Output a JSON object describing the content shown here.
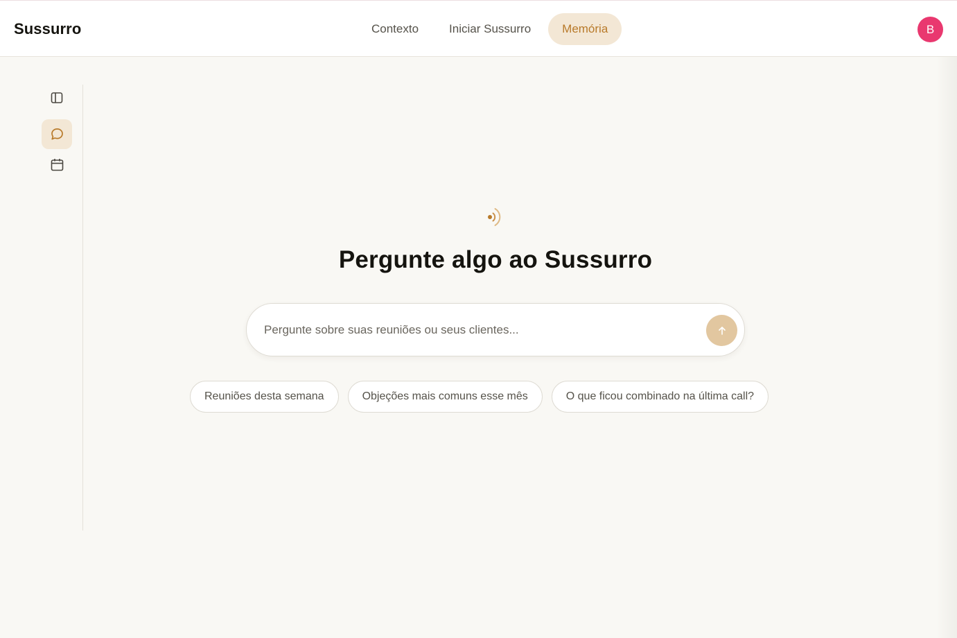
{
  "app": {
    "brand": "Sussurro"
  },
  "nav": {
    "items": [
      {
        "label": "Contexto",
        "active": false
      },
      {
        "label": "Iniciar Sussurro",
        "active": false
      },
      {
        "label": "Memória",
        "active": true
      }
    ]
  },
  "user": {
    "avatar_initial": "B",
    "avatar_color": "#e9386f"
  },
  "sidebar": {
    "items": [
      {
        "icon": "sidebar-toggle-icon",
        "active": false
      },
      {
        "icon": "chat-bubble-icon",
        "active": true
      },
      {
        "icon": "calendar-icon",
        "active": false
      }
    ]
  },
  "main": {
    "hero_icon": "sound-wave-icon",
    "title": "Pergunte algo ao Sussurro",
    "composer": {
      "value": "",
      "placeholder": "Pergunte sobre suas reuniões ou seus clientes...",
      "send_icon": "arrow-up-icon"
    },
    "suggestions": [
      "Reuniões desta semana",
      "Objeções mais comuns esse mês",
      "O que ficou combinado na última call?"
    ]
  },
  "colors": {
    "accent": "#b87a2a",
    "accent_bg": "#f3e7d5",
    "send_button": "#e2c7a0",
    "background": "#f9f8f4"
  }
}
